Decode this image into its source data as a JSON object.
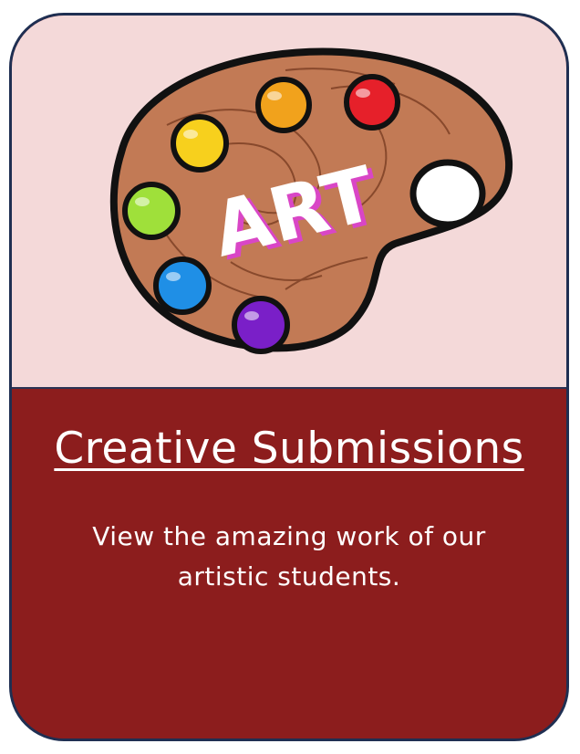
{
  "card": {
    "image_label": "ART",
    "title": "Creative Submissions",
    "description": "View the amazing work of our artistic students."
  },
  "colors": {
    "top_background": "#f4d9d9",
    "bottom_background": "#8c1d1d",
    "border": "#1f2f52",
    "palette": "#c27a55",
    "text": "#ffffff"
  },
  "icons": [
    "art-palette-icon"
  ],
  "paint_colors": [
    "#e6202a",
    "#f1a21c",
    "#f7d01d",
    "#9fe03a",
    "#1f8fe6",
    "#7a1fc8"
  ]
}
